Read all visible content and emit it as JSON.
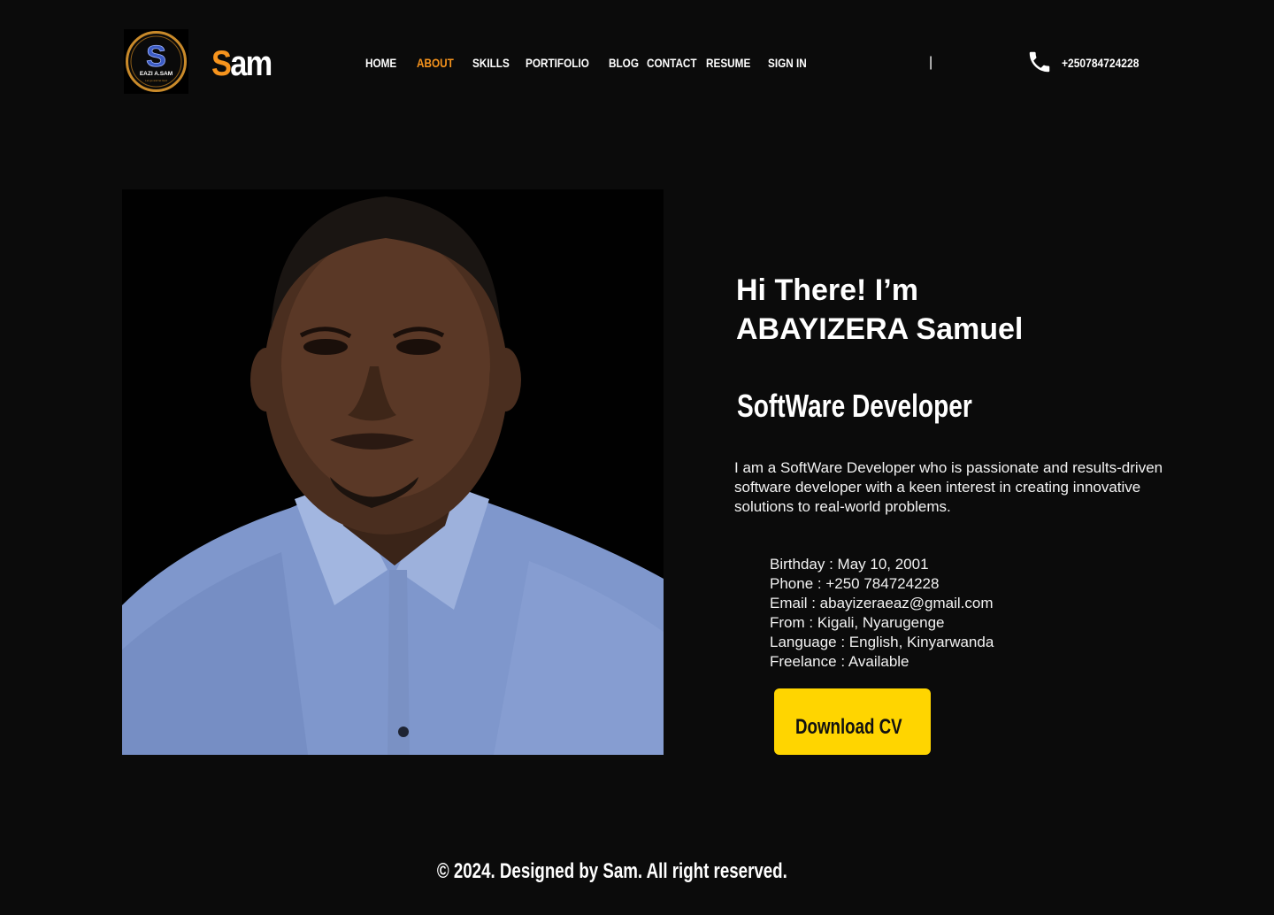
{
  "header": {
    "logo": {
      "badge_text": "EAZI A.SAM",
      "badge_tagline": "Let go and let God",
      "letter": "S"
    },
    "brand": {
      "first_letter": "S",
      "rest": "am"
    },
    "nav": [
      {
        "label": "HOME",
        "active": false
      },
      {
        "label": "ABOUT",
        "active": true
      },
      {
        "label": "SKILLS",
        "active": false
      },
      {
        "label": "PORTIFOLIO",
        "active": false
      },
      {
        "label": "BLOG",
        "active": false
      },
      {
        "label": "CONTACT",
        "active": false
      },
      {
        "label": "RESUME",
        "active": false
      },
      {
        "label": "SIGN IN",
        "active": false
      }
    ],
    "separator": "|",
    "phone_icon": "phone-icon",
    "phone": "+250784724228"
  },
  "hero": {
    "greeting_line1": "Hi There! I’m",
    "greeting_line2": "ABAYIZERA Samuel",
    "role": "SoftWare Developer",
    "bio": "I am a SoftWare Developer who is passionate and results-driven software developer with a keen interest in creating innovative solutions to real-world problems.",
    "details": [
      "Birthday : May 10, 2001",
      "Phone : +250 784724228",
      "Email : abayizeraeaz@gmail.com",
      "From : Kigali, Nyarugenge",
      "Language : English, Kinyarwanda",
      "Freelance : Available"
    ],
    "cv_button": "Download CV"
  },
  "footer": {
    "text": "© 2024. Designed by Sam. All right reserved."
  },
  "colors": {
    "background": "#0b0b0b",
    "accent": "#f7941d",
    "button": "#ffd500",
    "text": "#ffffff"
  }
}
